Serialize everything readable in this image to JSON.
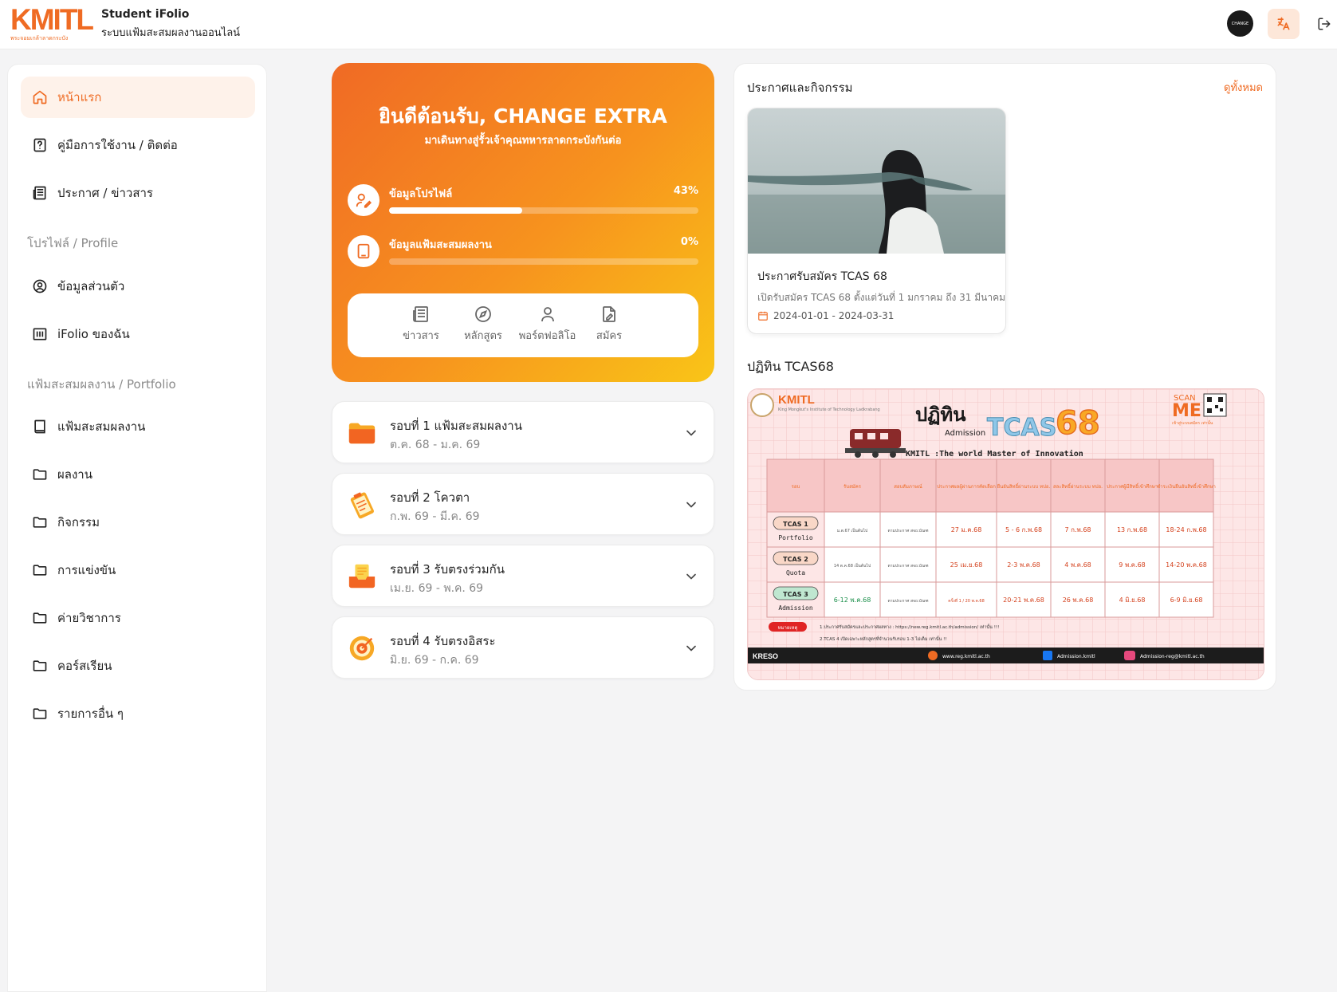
{
  "header": {
    "logo_text": "KMITL",
    "logo_sub": "พระจอมเกล้าลาดกระบัง",
    "title": "Student iFolio",
    "subtitle": "ระบบแฟ้มสะสมผลงานออนไลน์",
    "avatar_text": "CHANGE",
    "lang_icon": "translate-icon",
    "logout_icon": "logout-icon"
  },
  "sidebar": {
    "items": [
      {
        "label": "หน้าแรก",
        "icon": "home-icon",
        "active": true
      },
      {
        "label": "คู่มือการใช้งาน / ติดต่อ",
        "icon": "help-icon"
      },
      {
        "label": "ประกาศ / ข่าวสาร",
        "icon": "newspaper-icon"
      }
    ],
    "section_profile": "โปรไฟล์ / Profile",
    "profile_items": [
      {
        "label": "ข้อมูลส่วนตัว",
        "icon": "user-circle-icon"
      },
      {
        "label": "iFolio ของฉัน",
        "icon": "library-icon"
      }
    ],
    "section_portfolio": "แฟ้มสะสมผลงาน / Portfolio",
    "portfolio_items": [
      {
        "label": "แฟ้มสะสมผลงาน",
        "icon": "book-icon"
      },
      {
        "label": "ผลงาน",
        "icon": "folder-icon"
      },
      {
        "label": "กิจกรรม",
        "icon": "folder-icon"
      },
      {
        "label": "การแข่งขัน",
        "icon": "folder-icon"
      },
      {
        "label": "ค่ายวิชาการ",
        "icon": "folder-icon"
      },
      {
        "label": "คอร์สเรียน",
        "icon": "folder-icon"
      },
      {
        "label": "รายการอื่น ๆ",
        "icon": "folder-icon"
      }
    ]
  },
  "hero": {
    "title": "ยินดีต้อนรับ, CHANGE EXTRA",
    "subtitle": "มาเดินทางสู่รั้วเจ้าคุณทหารลาดกระบังกันต่อ",
    "progress": [
      {
        "label": "ข้อมูลโปรไฟล์",
        "percent_text": "43%",
        "value": 0.43
      },
      {
        "label": "ข้อมูลแฟ้มสะสมผลงาน",
        "percent_text": "0%",
        "value": 0
      }
    ],
    "quick_links": [
      {
        "label": "ข่าวสาร",
        "icon": "newspaper-icon"
      },
      {
        "label": "หลักสูตร",
        "icon": "compass-icon"
      },
      {
        "label": "พอร์ตฟอลิโอ",
        "icon": "user-icon"
      },
      {
        "label": "สมัคร",
        "icon": "file-signature-icon"
      }
    ]
  },
  "rounds": [
    {
      "title": "รอบที่ 1 แฟ้มสะสมผลงาน",
      "date": "ต.ค. 68 - ม.ค. 69",
      "icon": "folder-color-icon"
    },
    {
      "title": "รอบที่ 2 โควตา",
      "date": "ก.พ. 69 - มี.ค. 69",
      "icon": "clipboard-color-icon"
    },
    {
      "title": "รอบที่ 3 รับตรงร่วมกัน",
      "date": "เม.ย. 69 - พ.ค. 69",
      "icon": "inbox-color-icon"
    },
    {
      "title": "รอบที่ 4 รับตรงอิสระ",
      "date": "มิ.ย. 69 - ก.ค. 69",
      "icon": "target-color-icon"
    }
  ],
  "news": {
    "header": "ประกาศและกิจกรรม",
    "view_all": "ดูทั้งหมด",
    "card": {
      "title": "ประกาศรับสมัคร TCAS 68",
      "description": "เปิดรับสมัคร TCAS 68 ตั้งแต่วันที่ 1 มกราคม ถึง 31 มีนาคม",
      "date": "2024-01-01 - 2024-03-31"
    },
    "calendar_title": "ปฏิทิน TCAS68"
  },
  "poster": {
    "logo": "KMITL",
    "logo_sub": "King Mongkut's Institute of Technology Ladkrabang",
    "heading": "ปฏิทิน",
    "heading_sub": "Admission",
    "tcas": "TCAS",
    "year": "68",
    "scan": "SCAN",
    "me": "ME",
    "scan_sub": "เข้าสู่ระบบสมัคร เท่านั้น",
    "tagline": "KMITL :The world Master of Innovation",
    "columns": [
      "รอบ",
      "รับสมัคร",
      "สอบสัมภาษณ์",
      "ประกาศผลผู้ผ่านการคัดเลือก",
      "ยืนยันสิทธิ์ผ่านระบบ ทปอ.",
      "สละสิทธิ์ผ่านระบบ ทปอ.",
      "ประกาศผู้มีสิทธิ์เข้าศึกษา",
      "ชำระเงินยืนยันสิทธิ์เข้าศึกษา"
    ],
    "rows": [
      {
        "round": "TCAS 1",
        "round_sub": "Portfolio",
        "cells": [
          "ม.ต.67 เป็นต้นไป",
          "ตามประกาศ สจถ.บัณฑ",
          "27 ม.ค.68",
          "5 - 6 ก.พ.68",
          "7 ก.พ.68",
          "13 ก.พ.68",
          "18-24 ก.พ.68"
        ]
      },
      {
        "round": "TCAS 2",
        "round_sub": "Quota",
        "cells": [
          "14 ต.ค.68 เป็นต้นไป",
          "ตามประกาศ สจถ.บัณฑ",
          "25 เม.ย.68",
          "2-3 พ.ค.68",
          "4 พ.ค.68",
          "9 พ.ค.68",
          "14-20 พ.ค.68"
        ]
      },
      {
        "round": "TCAS 3",
        "round_sub": "Admission",
        "cells": [
          "6-12 พ.ค.68",
          "ตามประกาศ สจถ.บัณฑ",
          "ครั้งที่ 1 / 20 พ.ค.68",
          "20-21 พ.ค.68",
          "26 พ.ค.68",
          "4 มิ.ย.68",
          "6-9 มิ.ย.68"
        ]
      }
    ],
    "note_label": "หมายเหตุ",
    "note1": "1.ประกาศรับสมัครและประกาศผลทาง : https://new.reg.kmitl.ac.th/admission/ เท่านั้น !!!",
    "note2": "2.TCAS 4 เปิดเฉพาะหลักสูตรที่จำนวนรับรอบ 1-3 ไม่เต็ม เท่านั้น !!",
    "footer": [
      "KRESO",
      "www.reg.kmitl.ac.th",
      "Admission.kmitl",
      "Admission-reg@kmitl.ac.th"
    ]
  },
  "colors": {
    "accent": "#ef6b23",
    "accent_light": "#fef2ea",
    "hero_from": "#f06a25",
    "hero_to": "#f9c517"
  }
}
